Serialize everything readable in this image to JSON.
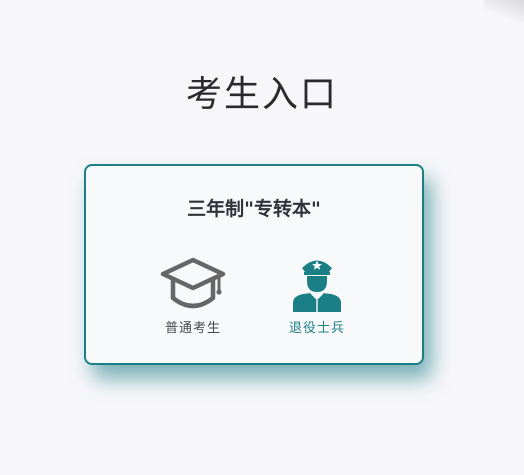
{
  "page": {
    "title": "考生入口"
  },
  "card": {
    "title": "三年制\"专转本\"",
    "options": [
      {
        "label": "普通考生",
        "icon": "graduation-cap-icon",
        "color": "#666666"
      },
      {
        "label": "退役士兵",
        "icon": "soldier-icon",
        "color": "#1b7f86"
      }
    ]
  },
  "colors": {
    "accent": "#1b7f86",
    "background": "#f7f7fa"
  }
}
